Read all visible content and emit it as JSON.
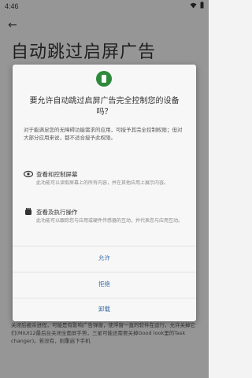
{
  "status_bar": {
    "time": "4:46"
  },
  "header": {
    "title": "自动跳过启屏广告"
  },
  "background_text": "关闭后被杀进程，可能是有影响广告弹窗，使浮窗一直的软件在运行，允许关掉它们(MIUI12最后台关闭全面屏手势，三星可能还需要关掉Good look里的Task changer)。若没有，则重启下手机",
  "dialog": {
    "title": "要允许自动跳过启屏广告完全控制您的设备吗？",
    "description": "对于能满足您的无障碍功能需求的应用，可授予其完全控制权限；但对大部分应用来说，都不适合授予此权限。",
    "permissions": [
      {
        "title": "查看和控制屏幕",
        "desc": "此功能可以读取屏幕上的所有内容，并在其他应用上展示内容。",
        "icon": "eye-icon"
      },
      {
        "title": "查看及执行操作",
        "desc": "此功能可以跟踪您与应用或硬件传感器的互动，并代表您与应用互动。",
        "icon": "hand-icon"
      }
    ],
    "buttons": {
      "allow": "允许",
      "deny": "拒绝",
      "uninstall": "卸载"
    },
    "accent_color": "#2e8a3b"
  }
}
